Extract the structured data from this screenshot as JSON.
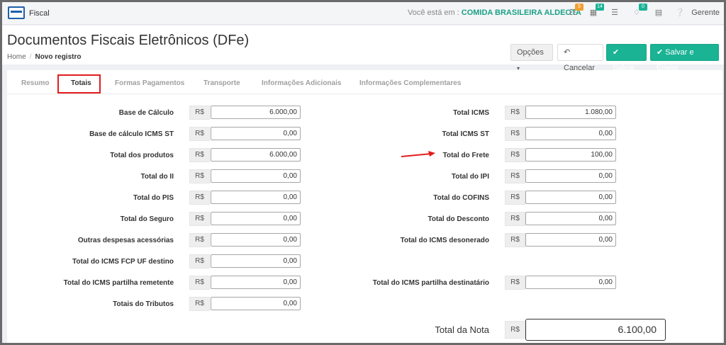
{
  "topbar": {
    "app_title": "Fiscal",
    "where_label": "Você está em :",
    "company": "COMIDA BRASILEIRA ALDEOTA",
    "badge1": "5",
    "badge2": "14",
    "badge3": "0",
    "user": "Gerente",
    "badge1_color": "#f0a030",
    "badge2_color": "#1ab394",
    "badge3_color": "#1ab394"
  },
  "header": {
    "page_title": "Documentos Fiscais Eletrônicos (DFe)",
    "breadcrumb_home": "Home",
    "breadcrumb_sep": "/",
    "breadcrumb_current": "Novo registro",
    "opcoes": "Opções",
    "cancel": "Cancelar",
    "salvar": "Salvar",
    "salvar_enviar": "Salvar e Enviar"
  },
  "tabs": [
    "Resumo",
    "Totais",
    "Formas Pagamentos",
    "Transporte",
    "Informações Adicionais",
    "Informações Complementares"
  ],
  "currency": "R$",
  "left_fields": [
    {
      "label": "Base de Cálculo",
      "value": "6.000,00"
    },
    {
      "label": "Base de cálculo ICMS ST",
      "value": "0,00"
    },
    {
      "label": "Total dos produtos",
      "value": "6.000,00"
    },
    {
      "label": "Total do II",
      "value": "0,00"
    },
    {
      "label": "Total do PIS",
      "value": "0,00"
    },
    {
      "label": "Total do Seguro",
      "value": "0,00"
    },
    {
      "label": "Outras despesas acessórias",
      "value": "0,00"
    },
    {
      "label": "Total do ICMS FCP UF destino",
      "value": "0,00"
    },
    {
      "label": "Total do ICMS partilha remetente",
      "value": "0,00"
    },
    {
      "label": "Totais do Tributos",
      "value": "0,00"
    }
  ],
  "right_fields": [
    {
      "label": "Total ICMS",
      "value": "1.080,00"
    },
    {
      "label": "Total ICMS ST",
      "value": "0,00"
    },
    {
      "label": "Total do Frete",
      "value": "100,00"
    },
    {
      "label": "Total do IPI",
      "value": "0,00"
    },
    {
      "label": "Total do COFINS",
      "value": "0,00"
    },
    {
      "label": "Total do Desconto",
      "value": "0,00"
    },
    {
      "label": "Total do ICMS desonerado",
      "value": "0,00"
    },
    {
      "label": "Total do ICMS partilha destinatário",
      "value": "0,00"
    }
  ],
  "total_nota": {
    "label": "Total da Nota",
    "value": "6.100,00"
  },
  "colors": {
    "accent": "#1ab394",
    "link": "#1aa086",
    "highlight": "#e31d1d"
  }
}
